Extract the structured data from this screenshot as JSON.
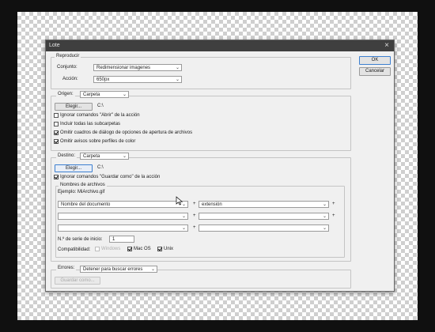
{
  "window": {
    "title": "Lote"
  },
  "buttons": {
    "ok": "OK",
    "cancel": "Cancelar"
  },
  "play": {
    "legend": "Reproducir",
    "set_label": "Conjunto:",
    "set_value": "Redimensionar imagenes",
    "action_label": "Acción:",
    "action_value": "650px"
  },
  "source": {
    "label": "Origen:",
    "value": "Carpeta",
    "choose_button": "Elegir...",
    "path": "C:\\",
    "options": [
      {
        "label": "Ignorar comandos \"Abrir\" de la acción",
        "checked": false
      },
      {
        "label": "Incluir todas las subcarpetas",
        "checked": false
      },
      {
        "label": "Omitir cuadros de diálogo de opciones de apertura de archivos",
        "checked": true
      },
      {
        "label": "Omitir avisos sobre perfiles de color",
        "checked": true
      }
    ]
  },
  "destination": {
    "label": "Destino:",
    "value": "Carpeta",
    "choose_button": "Elegir...",
    "path": "C:\\",
    "override_save": {
      "label": "Ignorar comandos \"Guardar como\" de la acción",
      "checked": true
    }
  },
  "naming": {
    "legend": "Nombres de archivos",
    "example": "Ejemplo: MiArchivo.gif",
    "rows": [
      [
        "Nombre del documento",
        "extensión"
      ],
      [
        "",
        ""
      ],
      [
        "",
        ""
      ]
    ],
    "serial_label": "N.º de serie de inicio:",
    "serial_value": "1",
    "compat_label": "Compatibilidad:",
    "compat": [
      {
        "label": "Windows",
        "checked": false,
        "disabled": true
      },
      {
        "label": "Mac OS",
        "checked": true,
        "disabled": false
      },
      {
        "label": "Unix",
        "checked": true,
        "disabled": false
      }
    ]
  },
  "errors": {
    "label": "Errores:",
    "value": "Detener para buscar errores",
    "save_as_button": "Guardar como..."
  },
  "icons": {
    "close": "close-icon",
    "dropdown": "chevron-down-icon",
    "cursor": "mouse-pointer-icon"
  }
}
